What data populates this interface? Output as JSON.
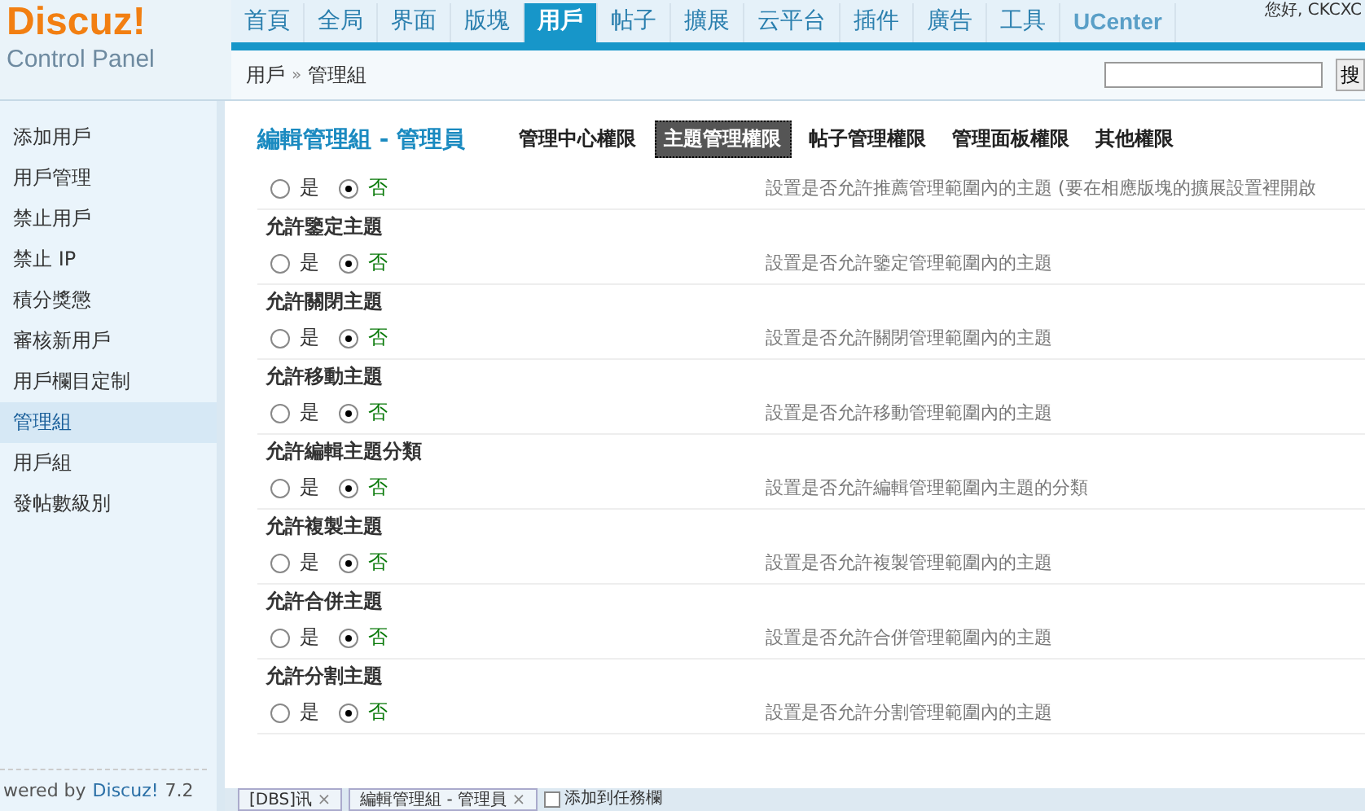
{
  "logo": {
    "brand": "Discuz!",
    "subtitle": "Control Panel"
  },
  "nav": [
    {
      "label": "首頁",
      "selected": false
    },
    {
      "label": "全局",
      "selected": false
    },
    {
      "label": "界面",
      "selected": false
    },
    {
      "label": "版塊",
      "selected": false
    },
    {
      "label": "用戶",
      "selected": true
    },
    {
      "label": "帖子",
      "selected": false
    },
    {
      "label": "擴展",
      "selected": false
    },
    {
      "label": "云平台",
      "selected": false
    },
    {
      "label": "插件",
      "selected": false
    },
    {
      "label": "廣告",
      "selected": false
    },
    {
      "label": "工具",
      "selected": false
    },
    {
      "label": "UCenter",
      "selected": false
    }
  ],
  "greeting": "您好, CKCXC",
  "breadcrumb": {
    "parent": "用戶",
    "sep": "»",
    "current": "管理組"
  },
  "search": {
    "button": "搜"
  },
  "sidebar": {
    "items": [
      {
        "label": "添加用戶",
        "selected": false
      },
      {
        "label": "用戶管理",
        "selected": false
      },
      {
        "label": "禁止用戶",
        "selected": false
      },
      {
        "label": "禁止 IP",
        "selected": false
      },
      {
        "label": "積分獎懲",
        "selected": false
      },
      {
        "label": "審核新用戶",
        "selected": false
      },
      {
        "label": "用戶欄目定制",
        "selected": false
      },
      {
        "label": "管理組",
        "selected": true
      },
      {
        "label": "用戶組",
        "selected": false
      },
      {
        "label": "發帖數級別",
        "selected": false
      }
    ],
    "footer": {
      "prefix": "wered by",
      "brand": "Discuz!",
      "version": "7.2"
    }
  },
  "page_title": "編輯管理組 - 管理員",
  "tabs": [
    {
      "label": "管理中心權限",
      "selected": false
    },
    {
      "label": "主題管理權限",
      "selected": true
    },
    {
      "label": "帖子管理權限",
      "selected": false
    },
    {
      "label": "管理面板權限",
      "selected": false
    },
    {
      "label": "其他權限",
      "selected": false
    }
  ],
  "settings": [
    {
      "yes": false,
      "yes_label": "是",
      "no_label": "否",
      "description": "設置是否允許推薦管理範圍內的主題 (要在相應版塊的擴展設置裡開啟"
    },
    {
      "title": "允許鑒定主題",
      "yes": false,
      "yes_label": "是",
      "no_label": "否",
      "description": "設置是否允許鑒定管理範圍內的主題"
    },
    {
      "title": "允許關閉主題",
      "yes": false,
      "yes_label": "是",
      "no_label": "否",
      "description": "設置是否允許關閉管理範圍內的主題"
    },
    {
      "title": "允許移動主題",
      "yes": false,
      "yes_label": "是",
      "no_label": "否",
      "description": "設置是否允許移動管理範圍內的主題"
    },
    {
      "title": "允許編輯主題分類",
      "yes": false,
      "yes_label": "是",
      "no_label": "否",
      "description": "設置是否允許編輯管理範圍內主題的分類"
    },
    {
      "title": "允許複製主題",
      "yes": false,
      "yes_label": "是",
      "no_label": "否",
      "description": "設置是否允許複製管理範圍內的主題"
    },
    {
      "title": "允許合併主題",
      "yes": false,
      "yes_label": "是",
      "no_label": "否",
      "description": "設置是否允許合併管理範圍內的主題"
    },
    {
      "title": "允許分割主題",
      "yes": false,
      "yes_label": "是",
      "no_label": "否",
      "description": "設置是否允許分割管理範圍內的主題"
    }
  ],
  "taskbar": [
    {
      "label": "[DBS]讯",
      "close": "×"
    },
    {
      "label": "編輯管理組 - 管理員",
      "close": "×"
    }
  ],
  "add_task": "添加到任務欄"
}
